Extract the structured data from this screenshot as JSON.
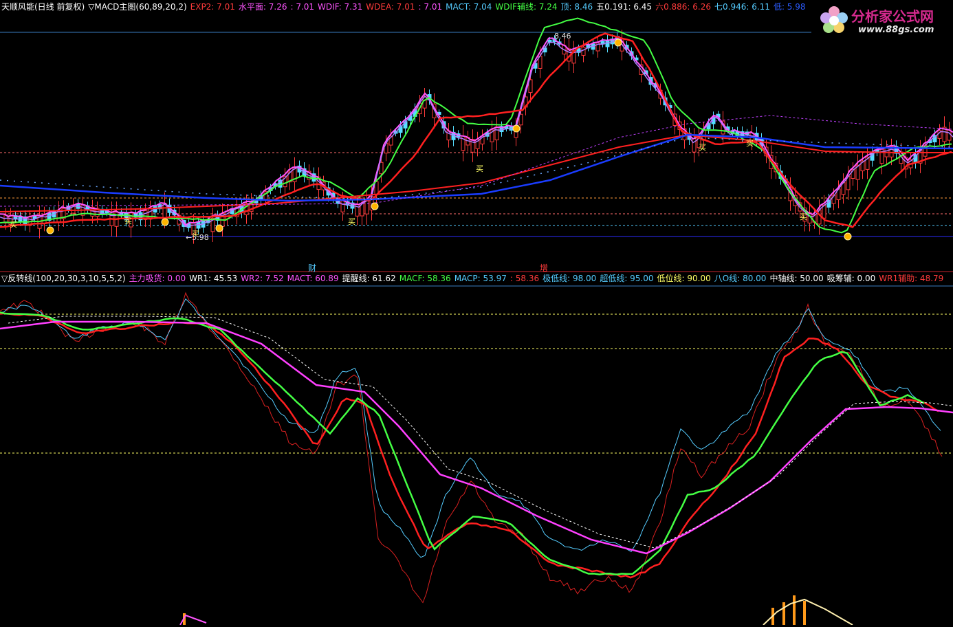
{
  "top_panel": {
    "title": "天顺风能(日线 前复权)",
    "indicator": "▽MACD主图(60,89,20,2)",
    "values": [
      {
        "label": "EXP2: 7.01",
        "color": "#ff3b3b"
      },
      {
        "label": "水平面: 7.26",
        "color": "#ff55ff"
      },
      {
        "label": ": 7.01",
        "color": "#ff55ff"
      },
      {
        "label": "WDIF: 7.31",
        "color": "#ff55ff"
      },
      {
        "label": "WDEA: 7.01",
        "color": "#ff3b3b"
      },
      {
        "label": ": 7.01",
        "color": "#ff55ff"
      },
      {
        "label": "MACT: 7.04",
        "color": "#55ccff"
      },
      {
        "label": "WDIF辅线: 7.24",
        "color": "#44ff44"
      },
      {
        "label": "顶: 8.46",
        "color": "#55ccff"
      },
      {
        "label": "五0.191: 6.45",
        "color": "#ffffff"
      },
      {
        "label": "六0.886: 6.26",
        "color": "#ff3b3b"
      },
      {
        "label": "七0.946: 6.11",
        "color": "#55ccff"
      },
      {
        "label": "低: 5.98",
        "color": "#2b5cff"
      }
    ],
    "peak_label": "8.46",
    "low_label": "←5.98",
    "buy_marker": "买"
  },
  "bottom_panel": {
    "indicator": "▽反转线(100,20,30,3,10,5,5,2)",
    "values": [
      {
        "label": "主力吸货: 0.00",
        "color": "#ff55ff"
      },
      {
        "label": "WR1: 45.53",
        "color": "#ffffff"
      },
      {
        "label": "WR2: 7.52",
        "color": "#ff55ff"
      },
      {
        "label": "MACT: 60.89",
        "color": "#ff55ff"
      },
      {
        "label": "提醒线: 61.62",
        "color": "#ffffff"
      },
      {
        "label": "MACF: 58.36",
        "color": "#44ff44"
      },
      {
        "label": "MACP: 53.97",
        "color": "#55ccff"
      },
      {
        "label": ": 58.36",
        "color": "#ff3b3b"
      },
      {
        "label": "极低线: 98.00",
        "color": "#55ccff"
      },
      {
        "label": "超低线: 95.00",
        "color": "#55ccff"
      },
      {
        "label": "低位线: 90.00",
        "color": "#ffff66"
      },
      {
        "label": "八O线: 80.00",
        "color": "#55ccff"
      },
      {
        "label": "中轴线: 50.00",
        "color": "#ffffff"
      },
      {
        "label": "吸筹辅: 0.00",
        "color": "#ffffff"
      },
      {
        "label": "WR1辅助: 48.79",
        "color": "#ff3b3b"
      }
    ]
  },
  "x_markers": [
    {
      "label": "财",
      "color": "#55ccff"
    },
    {
      "label": "增",
      "color": "#ff3b3b"
    }
  ],
  "logo": {
    "title": "分析家公式网",
    "url": "www.88gs.com"
  },
  "colors": {
    "background": "#000000",
    "up_candle": "#ff3b3b",
    "down_candle": "#55ddff",
    "divider": "#c8242e",
    "top_border": "#3a7bbf"
  }
}
